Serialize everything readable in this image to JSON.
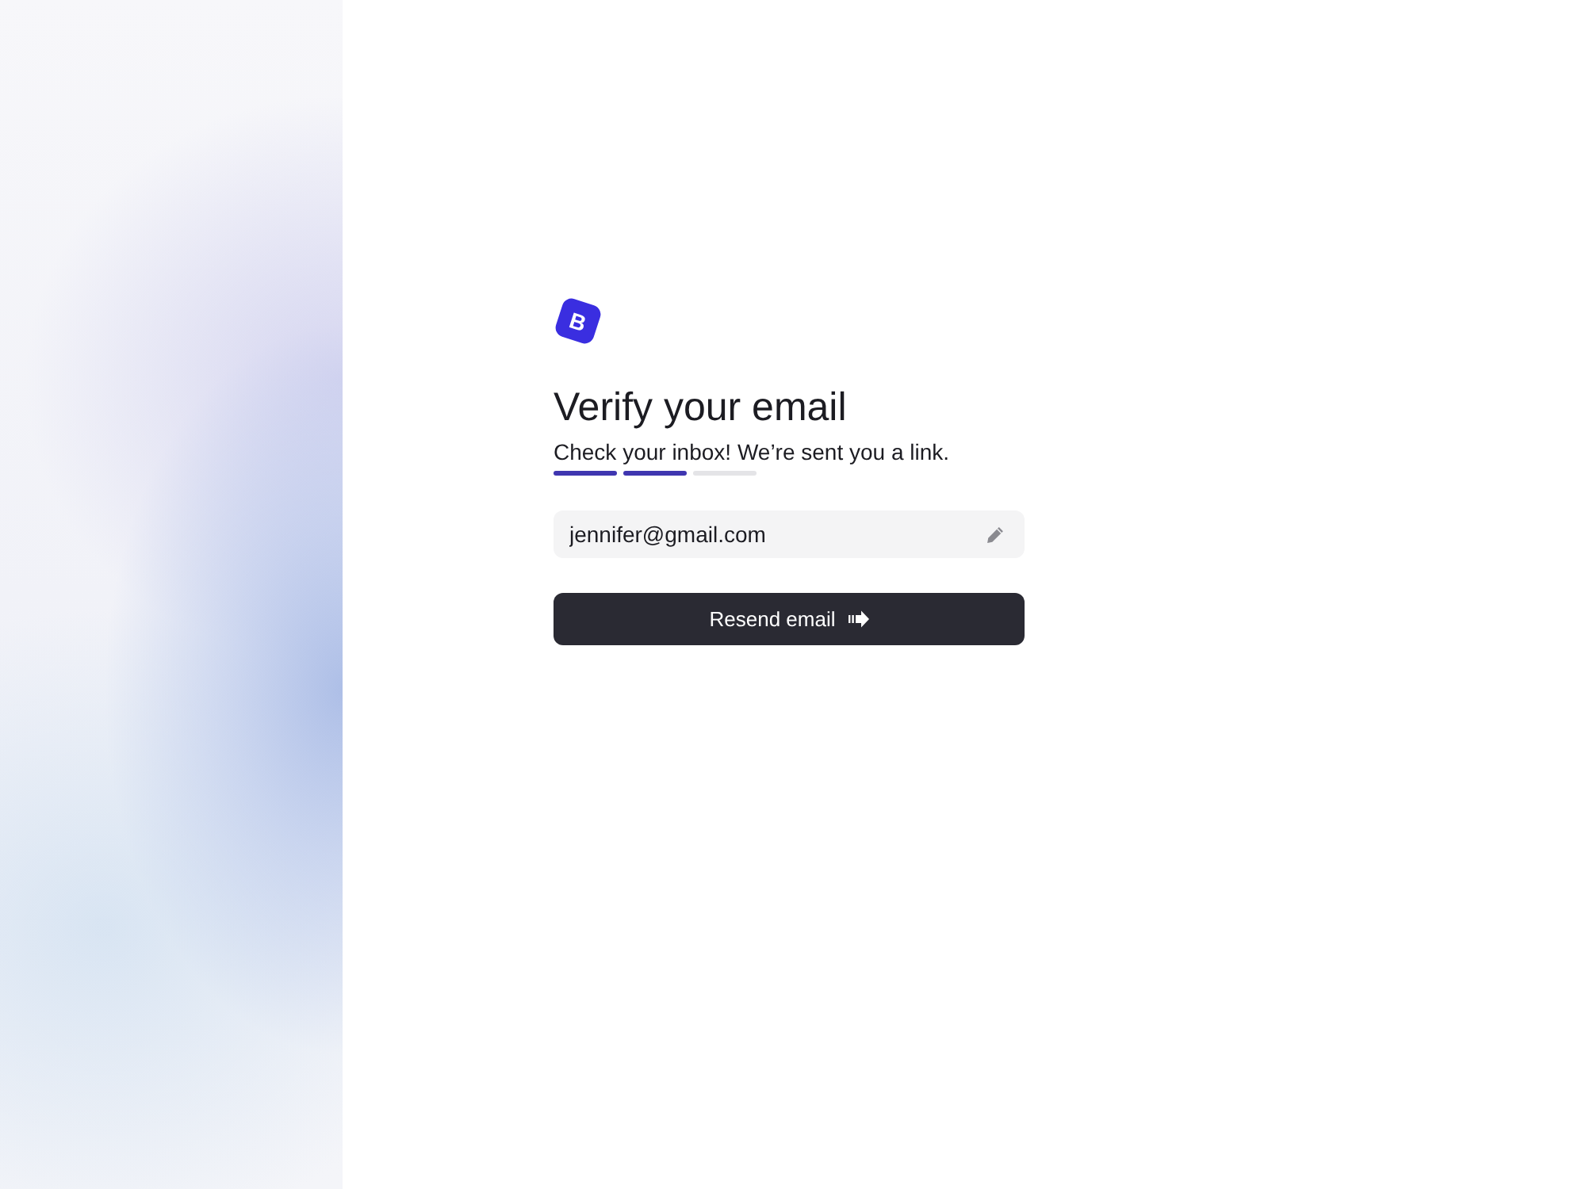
{
  "logo": {
    "letter": "B"
  },
  "heading": "Verify your email",
  "subtitle": "Check your inbox! We’re sent you a link.",
  "steps": [
    {
      "done": true
    },
    {
      "done": true
    },
    {
      "done": false
    }
  ],
  "email_field": {
    "value": "jennifer@gmail.com"
  },
  "resend_button": {
    "label": "Resend email"
  }
}
